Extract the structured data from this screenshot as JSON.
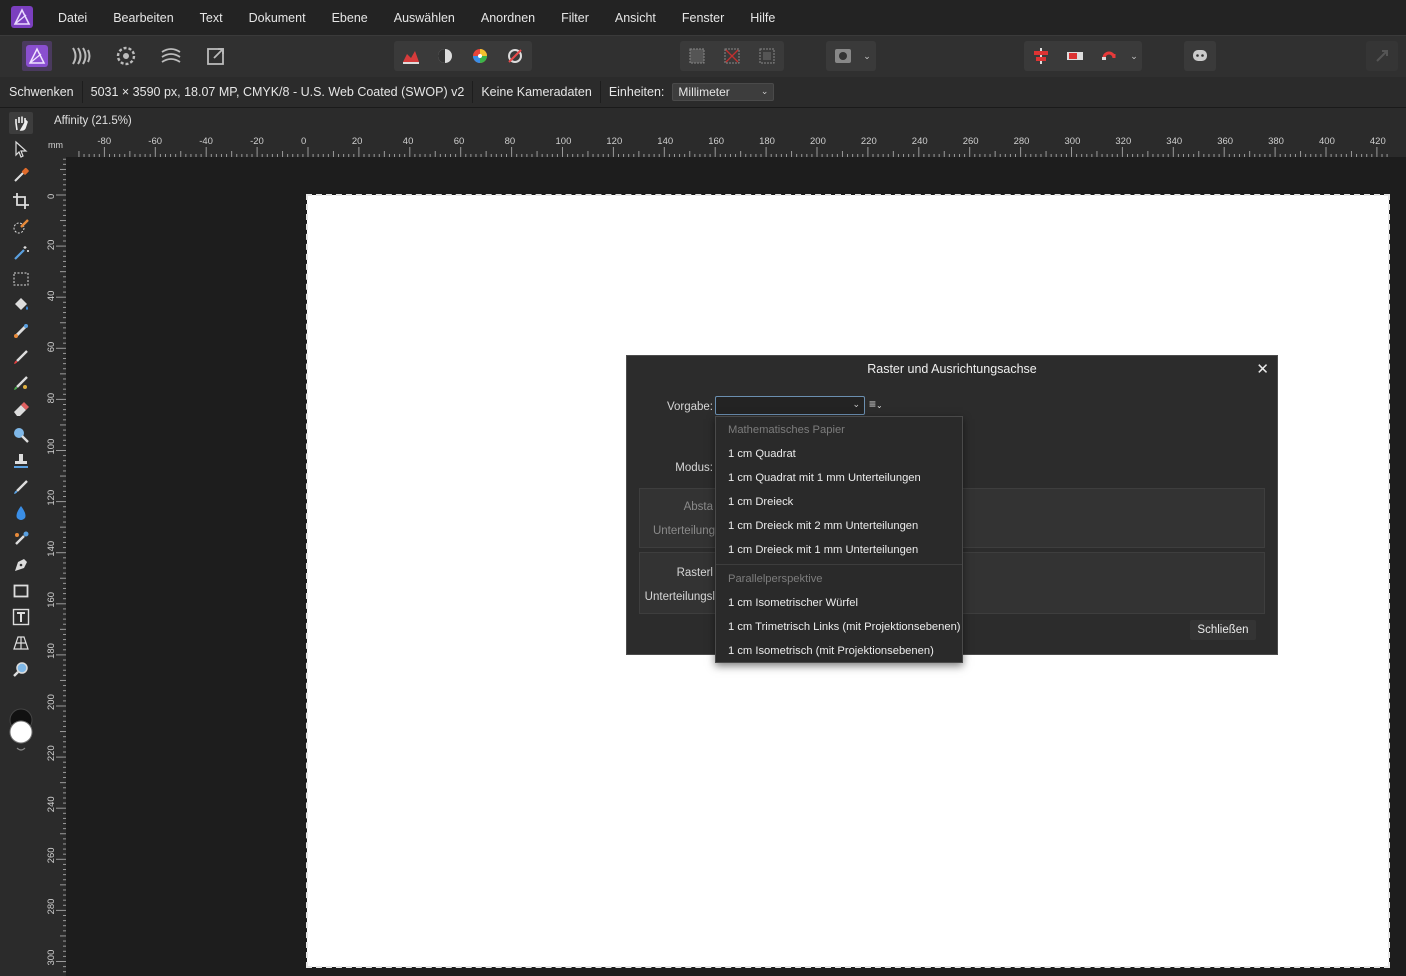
{
  "menubar": {
    "items": [
      "Datei",
      "Bearbeiten",
      "Text",
      "Dokument",
      "Ebene",
      "Auswählen",
      "Anordnen",
      "Filter",
      "Ansicht",
      "Fenster",
      "Hilfe"
    ]
  },
  "context": {
    "tool": "Schwenken",
    "doc_info": "5031 × 3590 px, 18.07 MP, CMYK/8 - U.S. Web Coated (SWOP) v2",
    "camera": "Keine Kameradaten",
    "units_label": "Einheiten:",
    "units_value": "Millimeter"
  },
  "document": {
    "tab_title": "Affinity (21.5%)"
  },
  "rulers": {
    "unit": "mm",
    "h_labels": [
      "-80",
      "-60",
      "-40",
      "-20",
      "0",
      "20",
      "40",
      "60",
      "80",
      "100",
      "120",
      "140",
      "160",
      "180",
      "200",
      "220",
      "240",
      "260",
      "280",
      "300",
      "320",
      "340",
      "360",
      "380",
      "400",
      "420"
    ],
    "v_labels": [
      "0",
      "20",
      "40",
      "60",
      "80",
      "100",
      "120",
      "140",
      "160",
      "180",
      "200",
      "220",
      "240",
      "260",
      "280",
      "300"
    ]
  },
  "dialog": {
    "title": "Raster und Ausrichtungsachse",
    "preset_label": "Vorgabe:",
    "mode_label": "Modus:",
    "spacing_label": "Absta",
    "subdiv_label": "Unterteilung",
    "grid_label": "Rasterl",
    "subdiv2_label": "Unterteilungsl",
    "close_label": "Schließen"
  },
  "dropdown": {
    "groups": [
      {
        "header": "Mathematisches Papier",
        "items": [
          "1 cm Quadrat",
          "1 cm Quadrat mit 1 mm Unterteilungen",
          "1 cm Dreieck",
          "1 cm Dreieck mit 2 mm Unterteilungen",
          "1 cm Dreieck mit 1 mm Unterteilungen"
        ]
      },
      {
        "header": "Parallelperspektive",
        "items": [
          "1 cm Isometrischer Würfel",
          "1 cm Trimetrisch Links (mit Projektionsebenen)",
          "1 cm Isometrisch (mit Projektionsebenen)"
        ]
      }
    ]
  }
}
